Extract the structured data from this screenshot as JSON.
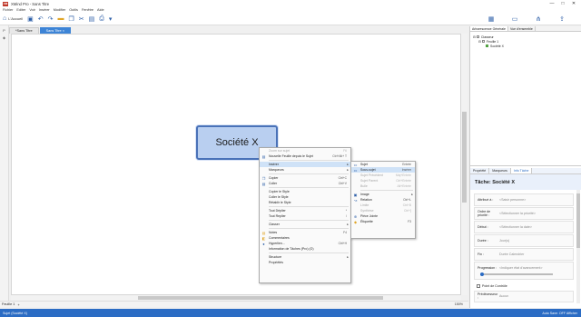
{
  "window": {
    "app_icon": "XM",
    "title": "XMind Pro - Sans Titre",
    "controls": [
      "—",
      "□",
      "✕"
    ]
  },
  "menu": [
    "Fichier",
    "Editer",
    "Voir",
    "Insérer",
    "Modifier",
    "Outils",
    "Fenêtre",
    "Aide"
  ],
  "toolbar": {
    "home_label": "L'Accueil",
    "icons": [
      "save-icon",
      "undo-icon",
      "redo-icon",
      "folder-icon",
      "copy-icon",
      "cut-icon",
      "paste-icon",
      "print-icon",
      "extra-icon"
    ]
  },
  "doc_tabs": [
    {
      "label": "*Sans Titre",
      "active": false
    },
    {
      "label": "Sans Titre ×",
      "active": true
    }
  ],
  "canvas": {
    "central_topic": "Société X",
    "sheet_tab": "Feuille 1",
    "zoom": "150%"
  },
  "status": {
    "left": "Sujet (Société X)",
    "right": "Auto Save: OFF   Afficher"
  },
  "right_panel": {
    "tabs": [
      "Arborescence Générale",
      "Vue d'ensemble"
    ],
    "tree": [
      {
        "label": "Classeur",
        "level": 0
      },
      {
        "label": "Feuille 1",
        "level": 1
      },
      {
        "label": "Société X",
        "level": 2
      }
    ],
    "bottom_tabs": [
      "Propriété",
      "Marqueurs",
      "Info Tâche"
    ],
    "task_title": "Tâche: Société X",
    "fields": [
      {
        "label": "Attribué à :",
        "value": "<Saisir personne>"
      },
      {
        "label": "Ordre de priorité :",
        "value": "<Sélectionner la priorité>"
      },
      {
        "label": "Début :",
        "value": "<Sélectionner la date>"
      },
      {
        "label": "Durée :",
        "value": "Jour(s)"
      },
      {
        "label": "Fin :",
        "value": "Durée  Calendrier"
      },
      {
        "label": "Progression :",
        "value": "<Indiquer état d'avancement>"
      }
    ],
    "progress": 0,
    "checkbox_label": "Point de Contrôle",
    "last_field": {
      "label": "Prédécesseur :",
      "value": "Aucun"
    }
  },
  "context_menu": [
    {
      "label": "Zoom sur sujet",
      "shortcut": "F6",
      "disabled": true
    },
    {
      "label": "Nouvelle Feuille depuis le Sujet",
      "shortcut": "Ctrl+Alt+ T",
      "icon": "new-sheet-icon"
    },
    {
      "sep": true
    },
    {
      "label": "Insérer",
      "arrow": true,
      "highlight": true
    },
    {
      "label": "Marqueurs",
      "arrow": true
    },
    {
      "sep": true
    },
    {
      "label": "Copier",
      "shortcut": "Ctrl+C",
      "icon": "copy-icon"
    },
    {
      "label": "Coller",
      "shortcut": "Ctrl+V",
      "icon": "paste-icon"
    },
    {
      "sep": true
    },
    {
      "label": "Copier le Style"
    },
    {
      "label": "Coller le Style"
    },
    {
      "label": "Rétablir le Style"
    },
    {
      "sep": true
    },
    {
      "label": "Tout Déplier",
      "shortcut": "*"
    },
    {
      "label": "Tout Replier",
      "shortcut": "/"
    },
    {
      "sep": true
    },
    {
      "label": "Classer",
      "arrow": true
    },
    {
      "sep": true
    },
    {
      "label": "Notes",
      "shortcut": "F4",
      "icon": "notes-icon"
    },
    {
      "label": "Commentaires",
      "icon": "comment-icon"
    },
    {
      "label": "Hyperlien...",
      "shortcut": "Ctrl+H",
      "icon": "hyperlink-icon"
    },
    {
      "label": "Information de Tâches (Pro) (O)"
    },
    {
      "sep": true
    },
    {
      "label": "Structure",
      "arrow": true
    },
    {
      "label": "Propriétés"
    }
  ],
  "submenu": [
    {
      "label": "Sujet",
      "shortcut": "Entrée",
      "icon": "topic-icon"
    },
    {
      "label": "Sous-sujet",
      "shortcut": "Insérer",
      "icon": "subtopic-icon",
      "highlight": true
    },
    {
      "label": "Sujet Précédent",
      "shortcut": "Maj+Entrée",
      "disabled": true
    },
    {
      "label": "Sujet Parent",
      "shortcut": "Ctrl+Entrée",
      "disabled": true
    },
    {
      "label": "Bulle",
      "shortcut": "Alt+Entrée",
      "disabled": true
    },
    {
      "sep": true
    },
    {
      "label": "Image",
      "arrow": true,
      "icon": "image-icon"
    },
    {
      "label": "Relation",
      "shortcut": "Ctrl+L",
      "icon": "relation-icon"
    },
    {
      "label": "Limite",
      "shortcut": "Ctrl+B",
      "disabled": true
    },
    {
      "label": "Synthèse",
      "shortcut": "Ctrl+]",
      "disabled": true
    },
    {
      "label": "Pièce Jointe",
      "icon": "attachment-icon"
    },
    {
      "label": "Étiquette",
      "shortcut": "F3",
      "icon": "label-icon"
    }
  ]
}
